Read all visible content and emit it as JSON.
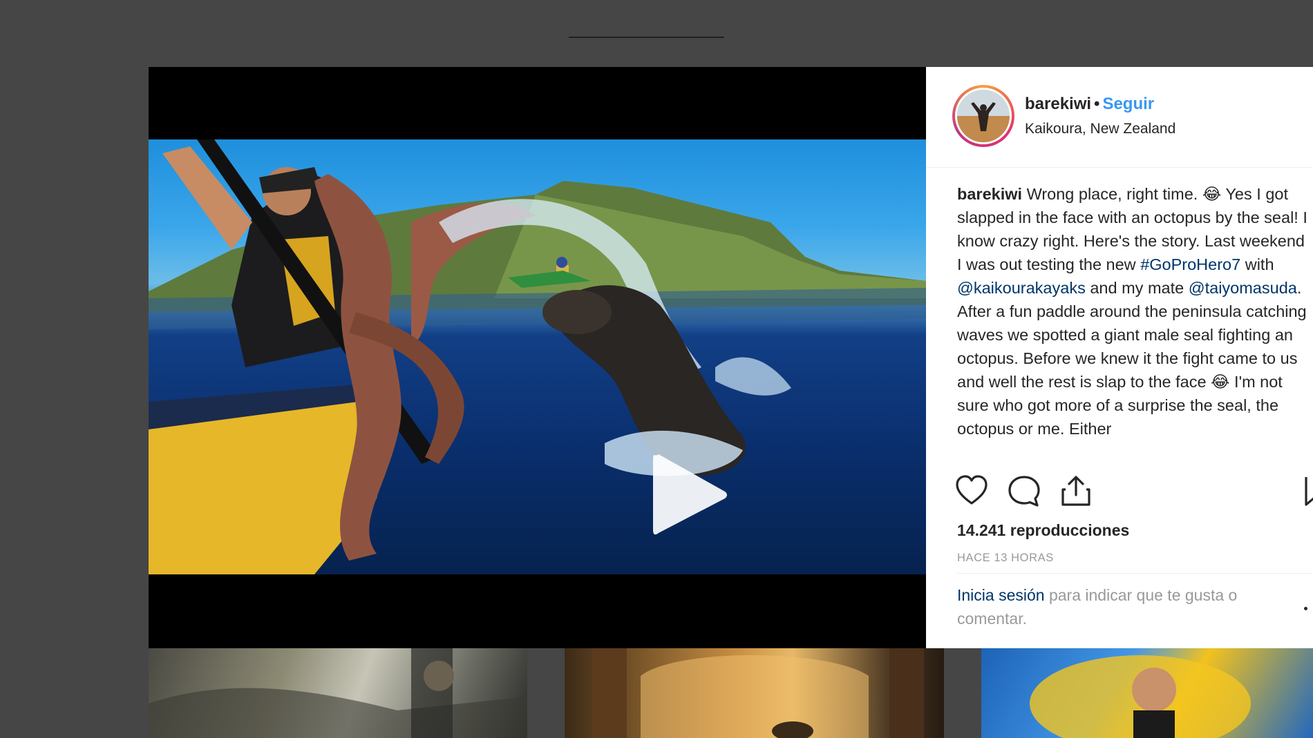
{
  "post": {
    "username": "barekiwi",
    "separator": "•",
    "follow_label": "Seguir",
    "location": "Kaikoura, New Zealand"
  },
  "caption": {
    "username": "barekiwi",
    "part1": " Wrong place, right time. 😂 Yes I got slapped in the face with an octopus by the seal! I know crazy right. Here's the story. Last weekend I was out testing the new ",
    "hashtag": "#GoProHero7",
    "part2": " with ",
    "mention1": "@kaikourakayaks",
    "part3": " and my mate ",
    "mention2": "@taiyomasuda",
    "part4": ". After a fun paddle around the peninsula catching waves we spotted a giant male seal fighting an octopus. Before we knew it the fight came to us and well the rest is slap to the face 😂 I'm not sure who got more of a surprise the seal, the octopus or me. Either"
  },
  "actions": {
    "like_icon": "heart-icon",
    "comment_icon": "comment-icon",
    "share_icon": "share-icon",
    "save_icon": "bookmark-icon"
  },
  "stats": {
    "views": "14.241 reproducciones",
    "timestamp": "HACE 13 HORAS"
  },
  "login_prompt": {
    "link": "Inicia sesión",
    "text": " para indicar que te gusta o comentar."
  },
  "colors": {
    "link_blue": "#3897f0",
    "text_dark": "#262626",
    "text_muted": "#999999",
    "background": "#464646"
  }
}
